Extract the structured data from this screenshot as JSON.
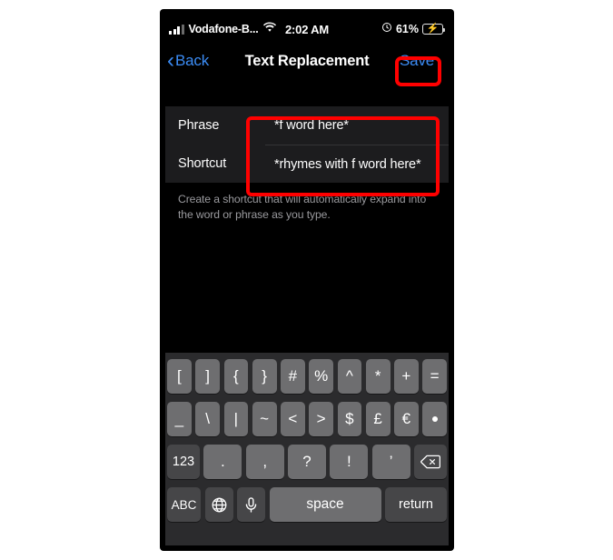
{
  "status_bar": {
    "carrier": "Vodafone-B...",
    "time": "2:02 AM",
    "battery_percent": "61%",
    "signal_icon": "signal-bars-icon",
    "wifi_icon": "wifi-icon",
    "alarm_icon": "alarm-clock-icon",
    "battery_icon": "battery-charging-icon"
  },
  "nav_bar": {
    "back_label": "Back",
    "title": "Text Replacement",
    "save_label": "Save",
    "accent_color": "#3b8cf5"
  },
  "form": {
    "rows": [
      {
        "label": "Phrase",
        "value": "*f word here*"
      },
      {
        "label": "Shortcut",
        "value": "*rhymes with f word here*"
      }
    ],
    "footer": "Create a shortcut that will automatically expand into the word or phrase as you type."
  },
  "annotations": {
    "highlight_color": "#ff0000",
    "boxes": [
      {
        "name": "save-button-highlight"
      },
      {
        "name": "text-fields-highlight"
      }
    ]
  },
  "keyboard": {
    "row1": [
      "[",
      "]",
      "{",
      "}",
      "#",
      "%",
      "^",
      "*",
      "+",
      "="
    ],
    "row2": [
      "_",
      "\\",
      "|",
      "~",
      "<",
      ">",
      "$",
      "£",
      "€",
      "•"
    ],
    "row3": [
      ".",
      ",",
      "?",
      "!",
      "’"
    ],
    "numeric_key": "123",
    "delete_key": "delete-icon",
    "abc_key": "ABC",
    "globe_key": "globe-icon",
    "mic_key": "microphone-icon",
    "space_key": "space",
    "return_key": "return"
  }
}
